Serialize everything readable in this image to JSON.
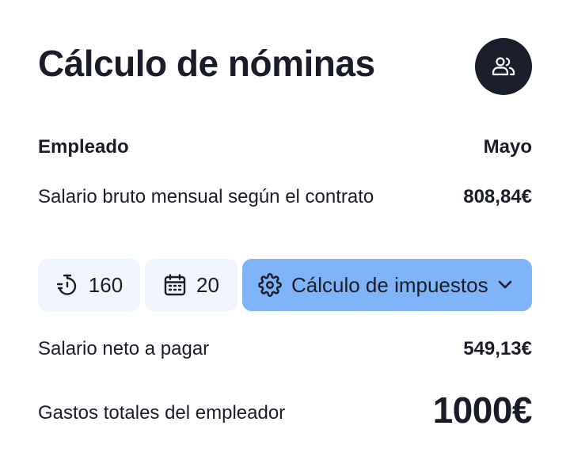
{
  "header": {
    "title": "Cálculo de nóminas",
    "avatar_icon": "users-icon"
  },
  "table": {
    "employee_label": "Empleado",
    "month_label": "Mayo"
  },
  "gross": {
    "label": "Salario bruto mensual según el contrato",
    "value": "808,84€"
  },
  "controls": {
    "hours": {
      "icon": "timer-icon",
      "value": "160"
    },
    "days": {
      "icon": "calendar-icon",
      "value": "20"
    },
    "tax": {
      "icon": "gear-icon",
      "label": "Cálculo de impuestos",
      "chevron": "chevron-down-icon"
    }
  },
  "net": {
    "label": "Salario neto a pagar",
    "value": "549,13€"
  },
  "total": {
    "label": "Gastos totales del empleador",
    "value": "1000€"
  },
  "colors": {
    "text": "#1a1d29",
    "avatar_bg": "#1b1e2b",
    "chip_bg": "#f0f5fd",
    "accent": "#7fb4f9"
  }
}
